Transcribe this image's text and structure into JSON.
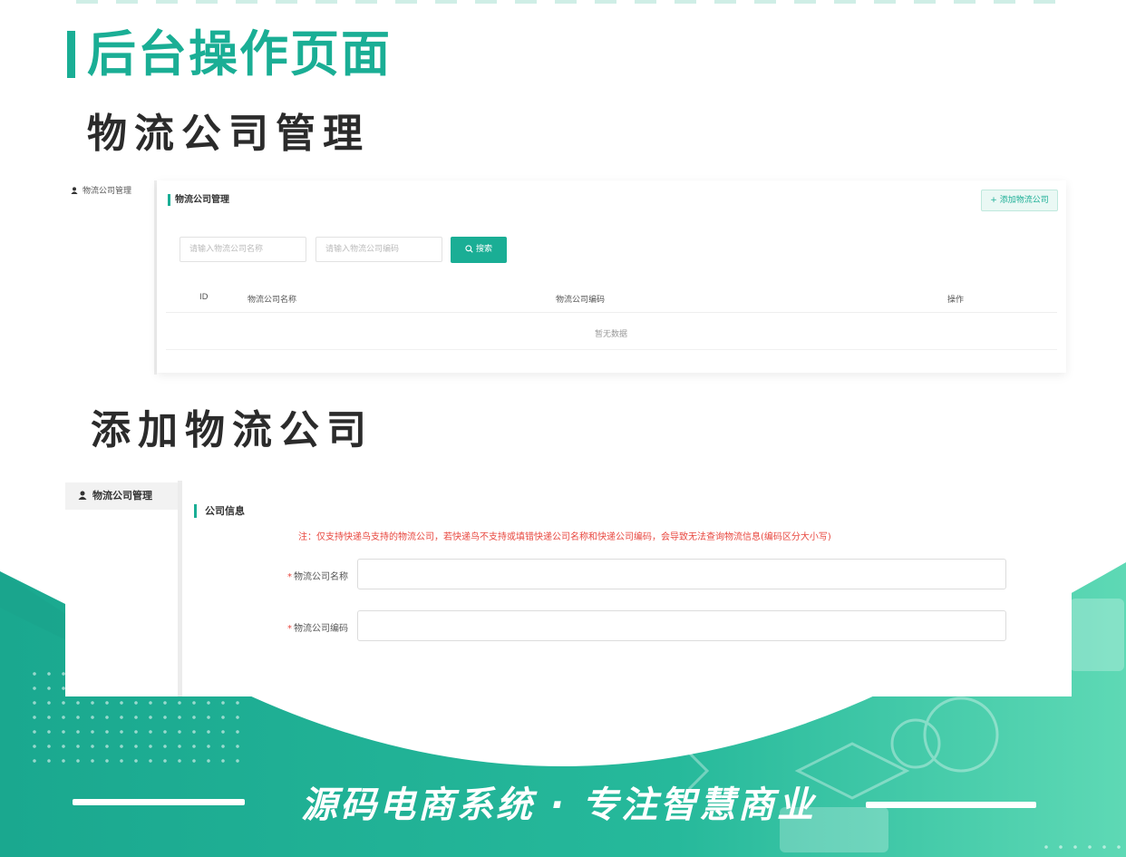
{
  "page_title": "后台操作页面",
  "section1_title": "物流公司管理",
  "section2_title": "添加物流公司",
  "panel1": {
    "sidebar_item": "物流公司管理",
    "header": "物流公司管理",
    "add_button": "+ 添加物流公司",
    "name_input_placeholder": "请输入物流公司名称",
    "code_input_placeholder": "请输入物流公司编码",
    "search_button": "搜索",
    "columns": [
      "ID",
      "物流公司名称",
      "物流公司编码",
      "操作"
    ],
    "empty_text": "暂无数据"
  },
  "panel2": {
    "sidebar_item": "物流公司管理",
    "section_header": "公司信息",
    "note": "注：仅支持快递鸟支持的物流公司，若快递鸟不支持或填错快递公司名称和快递公司编码，会导致无法查询物流信息(编码区分大小写)",
    "fields": [
      {
        "required_mark": "*",
        "label": "物流公司名称"
      },
      {
        "required_mark": "*",
        "label": "物流公司编码"
      }
    ]
  },
  "slogan": "源码电商系统 · 专注智慧商业",
  "colors": {
    "brand": "#1aae95",
    "brand_light": "#5dd8b6",
    "required": "#e8473f"
  }
}
